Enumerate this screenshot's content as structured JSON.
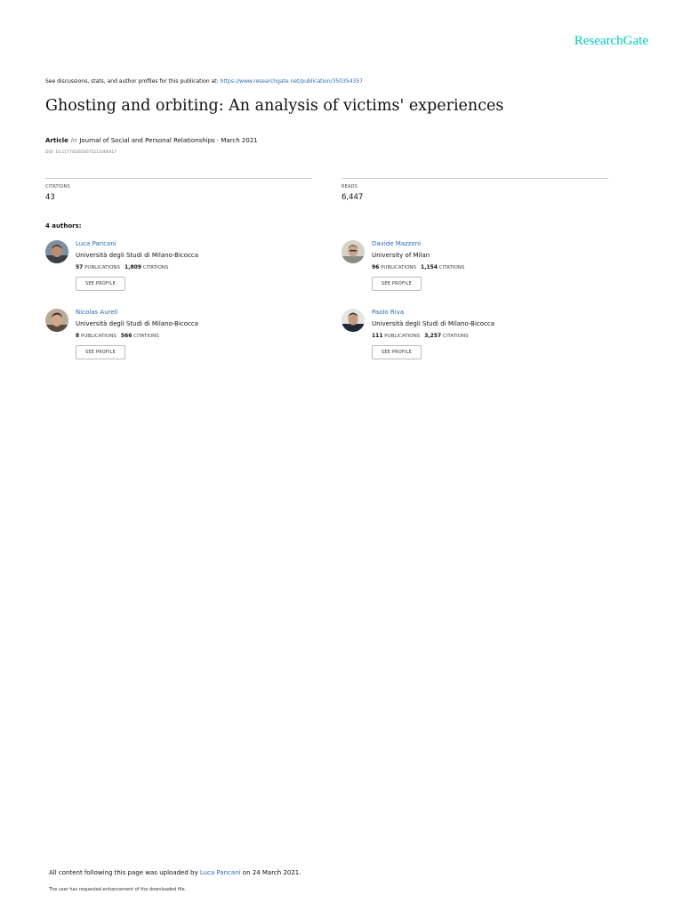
{
  "brand": "ResearchGate",
  "discussion": {
    "text": "See discussions, stats, and author profiles for this publication at: ",
    "link": "https://www.researchgate.net/publication/350354357"
  },
  "title": "Ghosting and orbiting: An analysis of victims' experiences",
  "meta": {
    "type": "Article",
    "in_word": "in",
    "journal": "Journal of Social and Personal Relationships · March 2021",
    "doi": "DOI: 10.1177/02654075211000417"
  },
  "stats": {
    "citations_label": "CITATIONS",
    "citations_value": "43",
    "reads_label": "READS",
    "reads_value": "6,447"
  },
  "authors_heading": "4 authors:",
  "authors": [
    {
      "name": "Luca Pancani",
      "institution": "Università degli Studi di Milano-Bicocca",
      "publications": "57",
      "publications_label": "PUBLICATIONS",
      "citations": "1,809",
      "citations_label": "CITATIONS",
      "button": "SEE PROFILE"
    },
    {
      "name": "Davide Mazzoni",
      "institution": "University of Milan",
      "publications": "96",
      "publications_label": "PUBLICATIONS",
      "citations": "1,154",
      "citations_label": "CITATIONS",
      "button": "SEE PROFILE"
    },
    {
      "name": "Nicolas Aureli",
      "institution": "Università degli Studi di Milano-Bicocca",
      "publications": "8",
      "publications_label": "PUBLICATIONS",
      "citations": "566",
      "citations_label": "CITATIONS",
      "button": "SEE PROFILE"
    },
    {
      "name": "Paolo Riva",
      "institution": "Università degli Studi di Milano-Bicocca",
      "publications": "111",
      "publications_label": "PUBLICATIONS",
      "citations": "3,257",
      "citations_label": "CITATIONS",
      "button": "SEE PROFILE"
    }
  ],
  "footer": {
    "upload_prefix": "All content following this page was uploaded by ",
    "uploader": "Luca Pancani",
    "upload_suffix": " on 24 March 2021.",
    "note": "The user has requested enhancement of the downloaded file."
  },
  "colors": {
    "brand": "#00ccbb",
    "link": "#2a6bb5"
  }
}
